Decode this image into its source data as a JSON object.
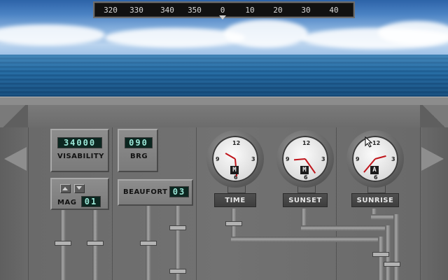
{
  "heading_tape": {
    "ticks": [
      "320",
      "330",
      "340",
      "350",
      "0",
      "10",
      "20",
      "30",
      "40"
    ]
  },
  "panel": {
    "visibility": {
      "value": "34000",
      "label": "VISABILITY"
    },
    "bearing": {
      "value": "090",
      "label": "BRG"
    },
    "magnification": {
      "value": "01",
      "label": "MAG"
    },
    "beaufort": {
      "value": "03",
      "label": "BEAUFORT"
    }
  },
  "clocks": [
    {
      "label": "TIME",
      "ampm": "M",
      "hour_deg": 300,
      "minute_deg": 175
    },
    {
      "label": "SUNSET",
      "ampm": "M",
      "hour_deg": 265,
      "minute_deg": 145
    },
    {
      "label": "SUNRISE",
      "ampm": "A",
      "hour_deg": 75,
      "minute_deg": 220
    }
  ],
  "colors": {
    "hand": "#c0141a",
    "lcd_text": "#9be8d8",
    "panel": "#727272"
  },
  "icons": {
    "left_nav": "arrow-left-icon",
    "right_nav": "arrow-right-icon"
  }
}
